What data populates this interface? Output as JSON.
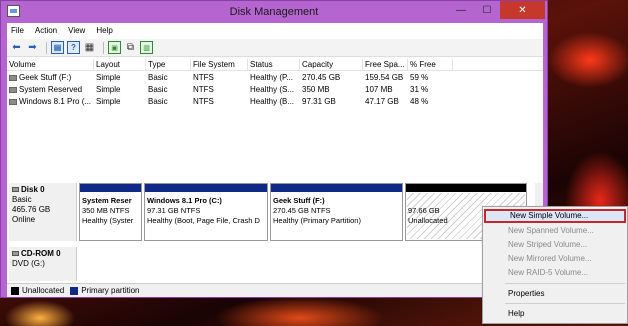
{
  "window": {
    "title": "Disk Management",
    "minimize": "—",
    "maximize": "☐",
    "close": "✕"
  },
  "menu": [
    "File",
    "Action",
    "View",
    "Help"
  ],
  "toolbar": {
    "icons": [
      "back-arrow-icon",
      "forward-arrow-icon",
      "console-icon",
      "help-icon",
      "properties-icon",
      "refresh-icon",
      "rescan-icon"
    ]
  },
  "list": {
    "headers": [
      "Volume",
      "Layout",
      "Type",
      "File System",
      "Status",
      "Capacity",
      "Free Spa...",
      "% Free"
    ],
    "rows": [
      [
        "Geek Stuff (F:)",
        "Simple",
        "Basic",
        "NTFS",
        "Healthy (P...",
        "270.45 GB",
        "159.54 GB",
        "59 %"
      ],
      [
        "System Reserved",
        "Simple",
        "Basic",
        "NTFS",
        "Healthy (S...",
        "350 MB",
        "107 MB",
        "31 %"
      ],
      [
        "Windows 8.1 Pro (...",
        "Simple",
        "Basic",
        "NTFS",
        "Healthy (B...",
        "97.31 GB",
        "47.17 GB",
        "48 %"
      ]
    ]
  },
  "disks": [
    {
      "name": "Disk 0",
      "type": "Basic",
      "size": "465.76 GB",
      "state": "Online"
    },
    {
      "name": "CD-ROM 0",
      "type": "DVD (G:)"
    }
  ],
  "partitions": [
    {
      "name": "System Reser",
      "size": "350 MB NTFS",
      "status": "Healthy (Syster"
    },
    {
      "name": "Windows 8.1 Pro  (C:)",
      "size": "97.31 GB NTFS",
      "status": "Healthy (Boot, Page File, Crash D"
    },
    {
      "name": "Geek Stuff  (F:)",
      "size": "270.45 GB NTFS",
      "status": "Healthy (Primary Partition)"
    },
    {
      "size": "97.66 GB",
      "status": "Unallocated"
    }
  ],
  "legend": {
    "unallocated": "Unallocated",
    "primary": "Primary partition"
  },
  "context_menu": {
    "items": [
      {
        "label": "New Simple Volume...",
        "enabled": true,
        "highlighted": true
      },
      {
        "label": "New Spanned Volume...",
        "enabled": false
      },
      {
        "label": "New Striped Volume...",
        "enabled": false
      },
      {
        "label": "New Mirrored Volume...",
        "enabled": false
      },
      {
        "label": "New RAID-5 Volume...",
        "enabled": false
      },
      {
        "label": "Properties",
        "enabled": true
      },
      {
        "label": "Help",
        "enabled": true
      }
    ]
  },
  "colors": {
    "frame": "#b565d0",
    "primary": "#0e2a86",
    "unallocated": "#000000",
    "highlight_border": "#c4282e"
  }
}
